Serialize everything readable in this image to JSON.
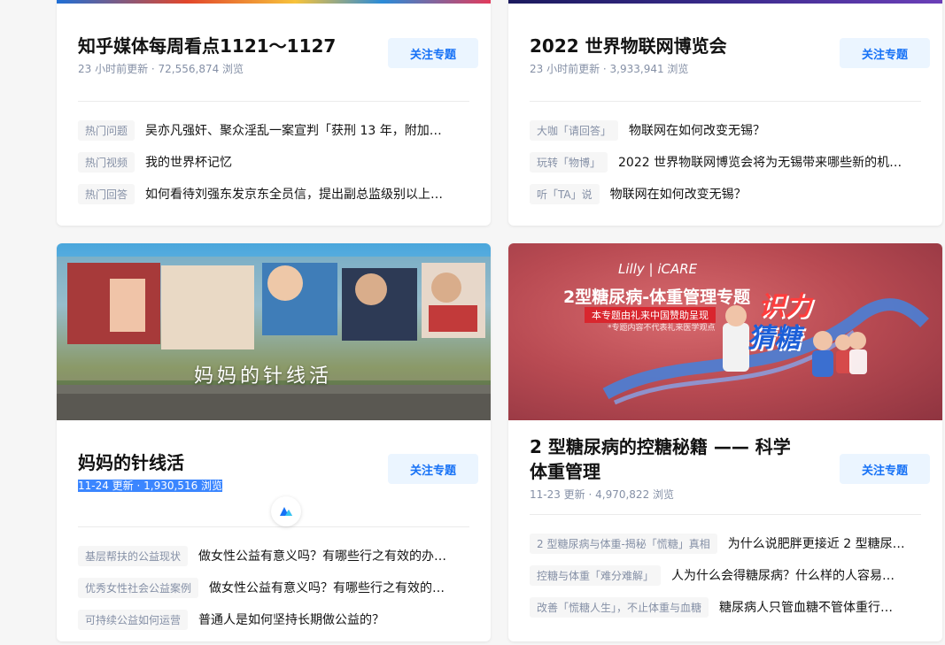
{
  "cards": [
    {
      "title": "知乎媒体每周看点1121～1127",
      "meta": "23 小时前更新 · 72,556,874 浏览",
      "follow_label": "关注专题",
      "items": [
        {
          "tag": "热门问题",
          "text": "吴亦凡强奸、聚众淫乱一案宣判「获刑 13 年，附加…"
        },
        {
          "tag": "热门视频",
          "text": "我的世界杯记忆"
        },
        {
          "tag": "热门回答",
          "text": "如何看待刘强东发京东全员信，提出副总监级别以上…"
        }
      ]
    },
    {
      "title": "2022 世界物联网博览会",
      "meta": "23 小时前更新 · 3,933,941 浏览",
      "follow_label": "关注专题",
      "items": [
        {
          "tag": "大咖「请回答」",
          "text": "物联网在如何改变无锡？"
        },
        {
          "tag": "玩转「物博」",
          "text": "2022 世界物联网博览会将为无锡带来哪些新的机…"
        },
        {
          "tag": "听「TA」说",
          "text": "物联网在如何改变无锡？"
        }
      ]
    },
    {
      "title": "妈妈的针线活",
      "meta_date": "11-24 更新",
      "meta_sep": " · ",
      "meta_views": "1,930,516 浏览",
      "banner_caption": "妈妈的针线活",
      "follow_label": "关注专题",
      "items": [
        {
          "tag": "基层帮扶的公益现状",
          "text": "做女性公益有意义吗？有哪些行之有效的办…"
        },
        {
          "tag": "优秀女性社会公益案例",
          "text": "做女性公益有意义吗？有哪些行之有效的…"
        },
        {
          "tag": "可持续公益如何运营",
          "text": "普通人是如何坚持长期做公益的？"
        }
      ]
    },
    {
      "title": "2 型糖尿病的控糖秘籍 —— 科学体重管理",
      "meta": "11-23 更新 · 4,970,822 浏览",
      "follow_label": "关注专题",
      "banner": {
        "brand": "Lilly | iCARE",
        "headline": "2型糖尿病-体重管理专题",
        "sponsor": "本专题由礼来中国赞助呈现",
        "disclaimer": "*专题内容不代表礼来医学观点",
        "slogan_1": "识力",
        "slogan_2": "猜糖"
      },
      "items": [
        {
          "tag": "2 型糖尿病与体重-揭秘「慌糖」真相",
          "text": "为什么说肥胖更接近 2 型糖尿…"
        },
        {
          "tag": "控糖与体重「难分难解」",
          "text": "人为什么会得糖尿病？什么样的人容易…"
        },
        {
          "tag": "改善「慌糖人生」，不止体重与血糖",
          "text": "糖尿病人只管血糖不管体重行…"
        }
      ]
    }
  ],
  "colors": {
    "accent": "#1772f6",
    "follow_bg": "#ebf5ff",
    "meta": "#8590a6",
    "selection": "#3b86ff"
  },
  "float_icon": "zhihu-assistant-icon"
}
